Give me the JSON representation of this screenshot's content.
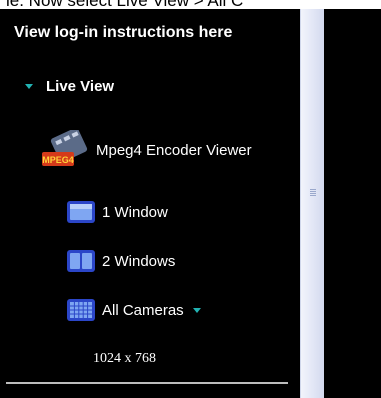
{
  "top_caption": "ie. Now select Live View > All C",
  "sidebar": {
    "login_link": "View log-in instructions here",
    "live_view_label": "Live View",
    "items": [
      {
        "label": "Mpeg4 Encoder Viewer",
        "icon": "mpeg4-icon"
      },
      {
        "label": "1 Window",
        "icon": "single-window-icon"
      },
      {
        "label": "2 Windows",
        "icon": "two-windows-icon"
      },
      {
        "label": "All Cameras",
        "icon": "grid-icon"
      }
    ],
    "resolution": "1024 x 768"
  },
  "colors": {
    "sidebar_bg": "#000000",
    "accent_triangle": "#22b3b3",
    "scrollbar": "#dfe4f4"
  }
}
